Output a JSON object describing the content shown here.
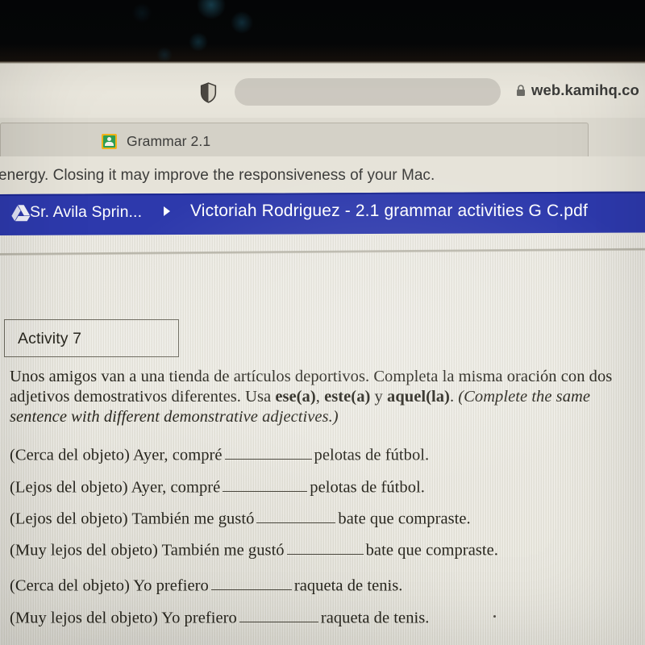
{
  "browser": {
    "shield_icon": "shield-icon",
    "address_bar": {
      "lock_icon": "lock-icon",
      "url": "web.kamihq.co"
    },
    "tab": {
      "favicon": "google-classroom-icon",
      "title": "Grammar 2.1"
    },
    "notification_text": "energy. Closing it may improve the responsiveness of your Mac."
  },
  "kami_bar": {
    "drive_icon": "google-drive-icon",
    "folder_label": "Sr. Avila Sprin...",
    "separator_icon": "chevron-right-icon",
    "document_name": "Victoriah Rodriguez - 2.1 grammar activities G C.pdf",
    "background_color": "#2d39ac"
  },
  "worksheet": {
    "activity_label": "Activity 7",
    "intro": {
      "part1": "Unos amigos van a una tienda de artículos deportivos. Completa la misma oración con dos adjetivos demostrativos diferentes. Usa ",
      "bold1": "ese(a)",
      "sep1": ", ",
      "bold2": "este(a)",
      "sep2": " y ",
      "bold3": "aquel(la)",
      "part2": ". ",
      "italic": "(Complete the same sentence with different demonstrative adjectives.)"
    },
    "questions": [
      {
        "prompt": "(Cerca del objeto) Ayer, compré",
        "blank_width": 108,
        "tail": "pelotas de fútbol."
      },
      {
        "prompt": "(Lejos del objeto) Ayer, compré",
        "blank_width": 105,
        "tail": "pelotas de fútbol."
      },
      {
        "prompt": "(Lejos del objeto) También me gustó",
        "blank_width": 98,
        "tail": "bate que compraste."
      },
      {
        "prompt": "(Muy lejos del objeto) También me gustó",
        "blank_width": 95,
        "tail": "bate que compraste."
      },
      {
        "prompt": "(Cerca del objeto) Yo prefiero",
        "blank_width": 100,
        "tail": "raqueta de tenis."
      },
      {
        "prompt": "(Muy lejos del objeto) Yo prefiero",
        "blank_width": 98,
        "tail": "raqueta de tenis."
      }
    ]
  }
}
